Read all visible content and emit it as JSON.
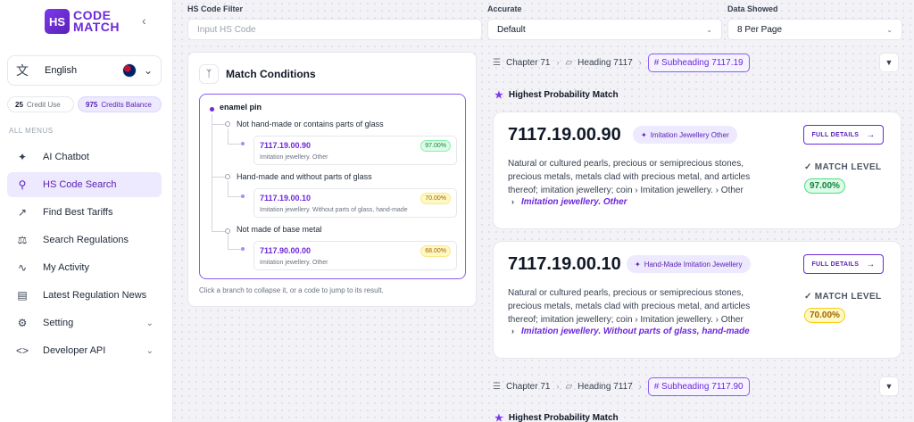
{
  "brand": {
    "logo_mark": "HS",
    "logo_line1": "CODE",
    "logo_line2": "MATCH"
  },
  "icons": {
    "collapse": "chevron-left-icon",
    "language": "translate-icon",
    "flag": "uk-flag-icon",
    "tree": "branch-icon",
    "breadcrumb_chapter": "layers-icon",
    "breadcrumb_heading": "folder-icon",
    "probability": "star-icon",
    "match_level": "check-circle-icon",
    "full_details": "arrow-right-icon",
    "expand": "chevron-down-icon"
  },
  "sidebar": {
    "language": "English",
    "credits": {
      "use_count": "25",
      "use_label": "Credit Use",
      "balance_count": "975",
      "balance_label": "Credits Balance"
    },
    "menu_heading": "ALL MENUS",
    "items": [
      {
        "label": "AI Chatbot",
        "icon": "sparkle-icon"
      },
      {
        "label": "HS Code Search",
        "icon": "search-icon",
        "active": true
      },
      {
        "label": "Find Best Tariffs",
        "icon": "trend-icon"
      },
      {
        "label": "Search Regulations",
        "icon": "scale-icon"
      },
      {
        "label": "My Activity",
        "icon": "activity-icon"
      },
      {
        "label": "Latest Regulation News",
        "icon": "newspaper-icon"
      },
      {
        "label": "Setting",
        "icon": "gear-icon",
        "expandable": true
      },
      {
        "label": "Developer API",
        "icon": "code-icon",
        "expandable": true
      }
    ]
  },
  "filters": {
    "hs_code": {
      "label": "HS Code Filter",
      "placeholder": "Input HS Code"
    },
    "accurate": {
      "label": "Accurate",
      "value": "Default"
    },
    "data_showed": {
      "label": "Data Showed",
      "value": "8 Per Page"
    }
  },
  "match_conditions": {
    "title": "Match Conditions",
    "root": "enamel pin",
    "branches": [
      {
        "label": "Not hand-made or contains parts of glass",
        "code": "7117.19.00.90",
        "desc": "Imitation jewellery. Other",
        "percent": "97.00%",
        "tone": "green"
      },
      {
        "label": "Hand-made and without parts of glass",
        "code": "7117.19.00.10",
        "desc": "Imitation jewellery. Without parts of glass, hand-made",
        "percent": "70.00%",
        "tone": "yellow"
      },
      {
        "label": "Not made of base metal",
        "code": "7117.90.00.00",
        "desc": "Imitation jewellery. Other",
        "percent": "68.00%",
        "tone": "yellow"
      }
    ],
    "hint": "Click a branch to collapse it, or a code to jump to its result."
  },
  "result_groups": [
    {
      "breadcrumb": {
        "chapter": "Chapter 71",
        "heading": "Heading 7117",
        "subheading": "# Subheading 7117.19"
      },
      "section_title": "Highest Probability Match",
      "results": [
        {
          "code": "7117.19.00.90",
          "tag": "Imitation Jewellery Other",
          "full_details": "FULL DETAILS",
          "desc": "Natural or cultured pearls, precious or semiprecious stones, precious metals, metals clad with precious metal, and articles thereof; imitation jewellery; coin  ›  Imitation jewellery.  ›  Other",
          "path": "Imitation jewellery. Other",
          "match_label": "MATCH LEVEL",
          "percent": "97.00%",
          "tone": "green"
        },
        {
          "code": "7117.19.00.10",
          "tag": "Hand-Made Imitation Jewellery",
          "full_details": "FULL DETAILS",
          "desc": "Natural or cultured pearls, precious or semiprecious stones, precious metals, metals clad with precious metal, and articles thereof; imitation jewellery; coin  ›  Imitation jewellery.  ›  Other",
          "path": "Imitation jewellery. Without parts of glass, hand-made",
          "match_label": "MATCH LEVEL",
          "percent": "70.00%",
          "tone": "yellow"
        }
      ]
    },
    {
      "breadcrumb": {
        "chapter": "Chapter 71",
        "heading": "Heading 7117",
        "subheading": "# Subheading 7117.90"
      },
      "section_title": "Highest Probability Match"
    }
  ]
}
